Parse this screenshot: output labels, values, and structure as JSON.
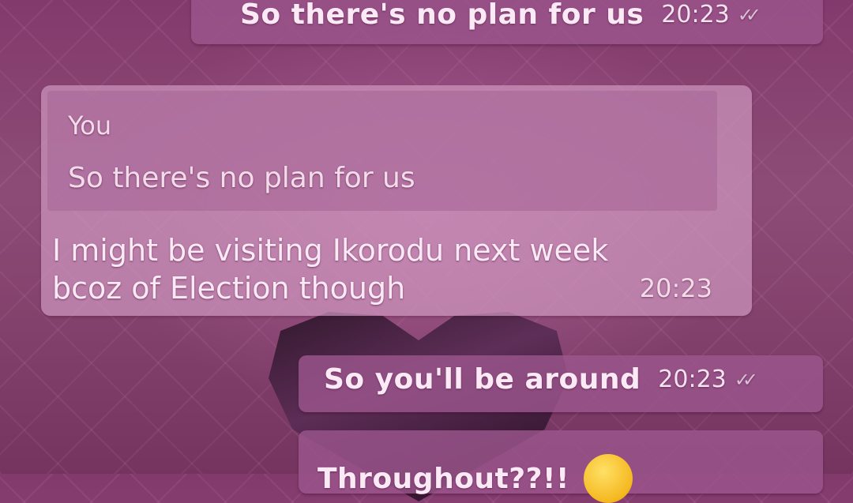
{
  "messages": [
    {
      "text": "So there's no plan for us",
      "time": "20:23",
      "ticks": "✓✓"
    },
    {
      "quote_author": "You",
      "quote_text": "So there's no plan for us",
      "line1": "I might be visiting Ikorodu next week",
      "line2": "bcoz of Election though",
      "time": "20:23"
    },
    {
      "text": "So you'll be around",
      "time": "20:23",
      "ticks": "✓✓"
    },
    {
      "text": "Throughout??!!",
      "emoji": "smiling-face-emoji"
    }
  ]
}
